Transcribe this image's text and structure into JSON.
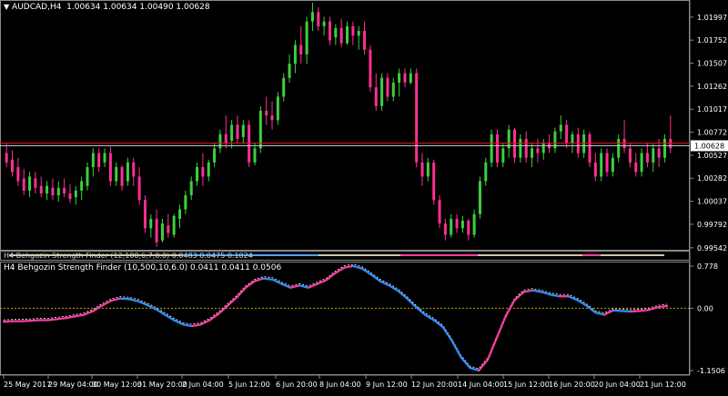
{
  "main": {
    "title": "AUDCAD,H4",
    "ohlc": "1.00634 1.00634 1.00490 1.00628",
    "current_price": "1.00628",
    "price_ticks": [
      "1.01997",
      "1.01752",
      "1.01507",
      "1.01262",
      "1.01017",
      "1.00772",
      "1.00527",
      "1.00282",
      "1.00037",
      "0.99792",
      "0.99542"
    ],
    "bull_color": "#3cd03c",
    "bear_color": "#ff2f92",
    "level_line_color": "#d7191c"
  },
  "strip": {
    "label": "H4 Behgozin Strength Finder (12,100,6,7,0.0)",
    "values": "0.0483 0.0475 0.1024"
  },
  "oscillator": {
    "label": "H4 Behgozin Strength Finder (10,500,10,6.0)",
    "values": "0.0411 0.0411 0.0506",
    "ticks": [
      "0.778",
      "0.00",
      "-1.1506"
    ],
    "zero_line_color": "#c8a000",
    "up_color": "#ff3da0",
    "down_color": "#2f8fff"
  },
  "time_axis": [
    "25 May 2017",
    "29 May 04:00",
    "30 May 12:00",
    "31 May 20:00",
    "2 Jun 04:00",
    "5 Jun 12:00",
    "6 Jun 20:00",
    "8 Jun 04:00",
    "9 Jun 12:00",
    "12 Jun 20:00",
    "14 Jun 04:00",
    "15 Jun 12:00",
    "16 Jun 20:00",
    "20 Jun 04:00",
    "21 Jun 12:00"
  ],
  "chart_data": {
    "type": "candlestick",
    "symbol": "AUDCAD",
    "timeframe": "H4",
    "ylim": [
      0.9954,
      1.0215
    ],
    "bars": [
      [
        1.0055,
        1.0065,
        1.004,
        1.0045
      ],
      [
        1.0048,
        1.0058,
        1.003,
        1.0035
      ],
      [
        1.004,
        1.005,
        1.002,
        1.0025
      ],
      [
        1.0028,
        1.0038,
        1.001,
        1.0015
      ],
      [
        1.0015,
        1.0035,
        1.0008,
        1.003
      ],
      [
        1.0028,
        1.0035,
        1.0012,
        1.0018
      ],
      [
        1.002,
        1.003,
        1.0008,
        1.0012
      ],
      [
        1.0012,
        1.0025,
        1.0005,
        1.002
      ],
      [
        1.0018,
        1.0028,
        1.0005,
        1.001
      ],
      [
        1.001,
        1.0025,
        1.0003,
        1.0018
      ],
      [
        1.0018,
        1.0028,
        1.0008,
        1.0012
      ],
      [
        1.0012,
        1.0022,
        1.0002,
        1.0006
      ],
      [
        1.0008,
        1.002,
        1.0,
        1.0015
      ],
      [
        1.0015,
        1.003,
        1.0005,
        1.0025
      ],
      [
        1.002,
        1.0045,
        1.0015,
        1.004
      ],
      [
        1.004,
        1.006,
        1.003,
        1.0055
      ],
      [
        1.0055,
        1.006,
        1.0035,
        1.004
      ],
      [
        1.0045,
        1.006,
        1.004,
        1.0055
      ],
      [
        1.0055,
        1.0062,
        1.002,
        1.0025
      ],
      [
        1.0025,
        1.0045,
        1.002,
        1.004
      ],
      [
        1.004,
        1.0042,
        1.0015,
        1.002
      ],
      [
        1.0025,
        1.005,
        1.002,
        1.0045
      ],
      [
        1.0045,
        1.005,
        1.002,
        1.003
      ],
      [
        1.003,
        1.004,
        1.0,
        1.0005
      ],
      [
        1.0005,
        1.001,
        0.997,
        0.9975
      ],
      [
        0.9975,
        0.999,
        0.9965,
        0.9985
      ],
      [
        0.9985,
        0.9995,
        0.9955,
        0.996
      ],
      [
        0.9962,
        0.9985,
        0.996,
        0.998
      ],
      [
        0.9978,
        0.999,
        0.9965,
        0.997
      ],
      [
        0.9968,
        0.999,
        0.9965,
        0.9988
      ],
      [
        0.9985,
        1.0,
        0.9975,
        0.9995
      ],
      [
        0.9995,
        1.0015,
        0.999,
        1.001
      ],
      [
        1.001,
        1.003,
        1.0005,
        1.0025
      ],
      [
        1.0025,
        1.0045,
        1.002,
        1.004
      ],
      [
        1.004,
        1.0055,
        1.002,
        1.003
      ],
      [
        1.003,
        1.0048,
        1.0025,
        1.0045
      ],
      [
        1.0045,
        1.0065,
        1.004,
        1.006
      ],
      [
        1.006,
        1.008,
        1.0055,
        1.0075
      ],
      [
        1.0075,
        1.0095,
        1.006,
        1.0065
      ],
      [
        1.0068,
        1.009,
        1.006,
        1.0085
      ],
      [
        1.0085,
        1.0095,
        1.0065,
        1.007
      ],
      [
        1.0072,
        1.009,
        1.0065,
        1.0085
      ],
      [
        1.0085,
        1.009,
        1.004,
        1.0045
      ],
      [
        1.0045,
        1.0065,
        1.0042,
        1.006
      ],
      [
        1.006,
        1.0105,
        1.0055,
        1.01
      ],
      [
        1.01,
        1.0115,
        1.0085,
        1.0095
      ],
      [
        1.0095,
        1.011,
        1.008,
        1.009
      ],
      [
        1.009,
        1.012,
        1.0085,
        1.0115
      ],
      [
        1.0115,
        1.014,
        1.011,
        1.0135
      ],
      [
        1.0135,
        1.016,
        1.013,
        1.015
      ],
      [
        1.015,
        1.0175,
        1.014,
        1.017
      ],
      [
        1.017,
        1.019,
        1.015,
        1.016
      ],
      [
        1.016,
        1.02,
        1.015,
        1.0195
      ],
      [
        1.0195,
        1.0215,
        1.0185,
        1.0205
      ],
      [
        1.0205,
        1.021,
        1.0185,
        1.019
      ],
      [
        1.019,
        1.02,
        1.018,
        1.0195
      ],
      [
        1.0195,
        1.02,
        1.017,
        1.0175
      ],
      [
        1.0178,
        1.0192,
        1.017,
        1.0188
      ],
      [
        1.0188,
        1.0198,
        1.0168,
        1.0172
      ],
      [
        1.0172,
        1.0195,
        1.017,
        1.019
      ],
      [
        1.019,
        1.0195,
        1.017,
        1.018
      ],
      [
        1.018,
        1.019,
        1.0165,
        1.0185
      ],
      [
        1.0185,
        1.0195,
        1.016,
        1.0165
      ],
      [
        1.0165,
        1.017,
        1.012,
        1.0125
      ],
      [
        1.0125,
        1.014,
        1.01,
        1.0105
      ],
      [
        1.0105,
        1.014,
        1.01,
        1.0135
      ],
      [
        1.0135,
        1.014,
        1.011,
        1.0115
      ],
      [
        1.0115,
        1.0135,
        1.011,
        1.013
      ],
      [
        1.013,
        1.0145,
        1.0115,
        1.014
      ],
      [
        1.014,
        1.0145,
        1.0125,
        1.013
      ],
      [
        1.013,
        1.0145,
        1.0128,
        1.014
      ],
      [
        1.014,
        1.0145,
        1.004,
        1.0045
      ],
      [
        1.0045,
        1.0055,
        1.002,
        1.003
      ],
      [
        1.003,
        1.005,
        1.0025,
        1.0045
      ],
      [
        1.0045,
        1.0048,
        1.0,
        1.0005
      ],
      [
        1.0005,
        1.001,
        0.9975,
        0.998
      ],
      [
        0.998,
        0.9985,
        0.9962,
        0.9968
      ],
      [
        0.9968,
        0.999,
        0.9965,
        0.9985
      ],
      [
        0.9985,
        0.999,
        0.997,
        0.9975
      ],
      [
        0.9975,
        0.9988,
        0.997,
        0.9983
      ],
      [
        0.9983,
        0.9985,
        0.9962,
        0.9968
      ],
      [
        0.9968,
        0.9995,
        0.9965,
        0.999
      ],
      [
        0.999,
        1.003,
        0.9985,
        1.0025
      ],
      [
        1.0025,
        1.005,
        1.002,
        1.0045
      ],
      [
        1.0045,
        1.008,
        1.004,
        1.0075
      ],
      [
        1.0075,
        1.008,
        1.004,
        1.0045
      ],
      [
        1.0045,
        1.0065,
        1.004,
        1.006
      ],
      [
        1.006,
        1.0085,
        1.005,
        1.008
      ],
      [
        1.008,
        1.0082,
        1.0045,
        1.005
      ],
      [
        1.005,
        1.0075,
        1.0045,
        1.007
      ],
      [
        1.007,
        1.0078,
        1.0045,
        1.005
      ],
      [
        1.005,
        1.0065,
        1.004,
        1.006
      ],
      [
        1.006,
        1.007,
        1.0045,
        1.0055
      ],
      [
        1.0055,
        1.007,
        1.0048,
        1.0065
      ],
      [
        1.0065,
        1.0075,
        1.0055,
        1.006
      ],
      [
        1.006,
        1.0082,
        1.0055,
        1.0078
      ],
      [
        1.0078,
        1.0095,
        1.007,
        1.0085
      ],
      [
        1.0085,
        1.009,
        1.006,
        1.0065
      ],
      [
        1.0065,
        1.0078,
        1.0055,
        1.0075
      ],
      [
        1.0075,
        1.0082,
        1.005,
        1.0055
      ],
      [
        1.0055,
        1.008,
        1.005,
        1.0075
      ],
      [
        1.0075,
        1.0078,
        1.004,
        1.0045
      ],
      [
        1.0045,
        1.0055,
        1.0025,
        1.003
      ],
      [
        1.003,
        1.006,
        1.0025,
        1.0055
      ],
      [
        1.0055,
        1.006,
        1.003,
        1.0035
      ],
      [
        1.0035,
        1.0055,
        1.003,
        1.005
      ],
      [
        1.005,
        1.0075,
        1.0045,
        1.007
      ],
      [
        1.007,
        1.009,
        1.0055,
        1.006
      ],
      [
        1.006,
        1.0065,
        1.004,
        1.0045
      ],
      [
        1.0045,
        1.0055,
        1.003,
        1.0035
      ],
      [
        1.0035,
        1.006,
        1.003,
        1.0055
      ],
      [
        1.0055,
        1.0065,
        1.004,
        1.0045
      ],
      [
        1.0045,
        1.0065,
        1.0035,
        1.006
      ],
      [
        1.006,
        1.007,
        1.004,
        1.005
      ],
      [
        1.005,
        1.0075,
        1.0045,
        1.007
      ],
      [
        1.007,
        1.0095,
        1.0055,
        1.006
      ]
    ],
    "oscillator": [
      -0.25,
      -0.24,
      -0.24,
      -0.23,
      -0.22,
      -0.22,
      -0.2,
      -0.18,
      -0.15,
      -0.12,
      -0.05,
      0.05,
      0.14,
      0.18,
      0.17,
      0.13,
      0.06,
      -0.02,
      -0.12,
      -0.22,
      -0.3,
      -0.33,
      -0.3,
      -0.22,
      -0.1,
      0.05,
      0.2,
      0.38,
      0.5,
      0.55,
      0.53,
      0.45,
      0.38,
      0.42,
      0.38,
      0.45,
      0.52,
      0.65,
      0.75,
      0.78,
      0.73,
      0.62,
      0.5,
      0.42,
      0.32,
      0.18,
      0.02,
      -0.12,
      -0.22,
      -0.35,
      -0.6,
      -0.9,
      -1.1,
      -1.15,
      -0.95,
      -0.55,
      -0.15,
      0.15,
      0.3,
      0.33,
      0.3,
      0.25,
      0.22,
      0.22,
      0.15,
      0.05,
      -0.08,
      -0.12,
      -0.04,
      -0.05,
      -0.06,
      -0.05,
      -0.03,
      0.02,
      0.04
    ],
    "oscillator_ylim": [
      -1.1506,
      0.778
    ]
  }
}
